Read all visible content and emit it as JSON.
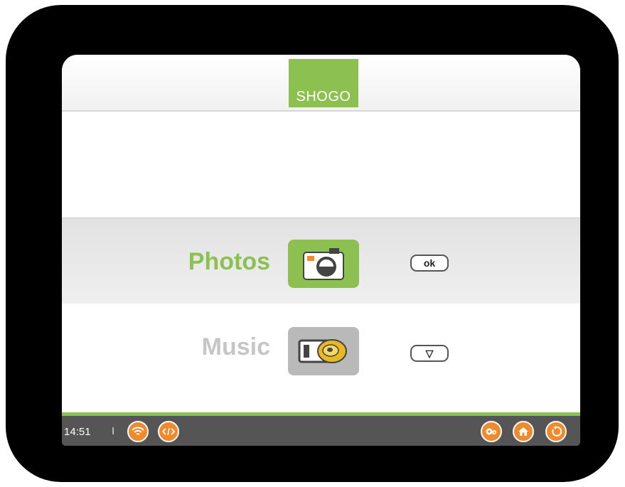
{
  "header": {
    "logo_text": "SHOGO"
  },
  "menu": {
    "items": [
      {
        "label": "Photos",
        "icon": "camera-icon",
        "button_label": "ok",
        "selected": true
      },
      {
        "label": "Music",
        "icon": "disc-player-icon",
        "button_label": "▽",
        "selected": false
      }
    ]
  },
  "status": {
    "time": "14:51",
    "separator": "I",
    "left_icons": [
      "wifi-icon",
      "code-icon"
    ],
    "right_icons": [
      "settings-icon",
      "home-icon",
      "back-icon"
    ]
  },
  "colors": {
    "accent_green": "#8cc152",
    "icon_orange": "#f08a2c",
    "statusbar": "#555555"
  }
}
